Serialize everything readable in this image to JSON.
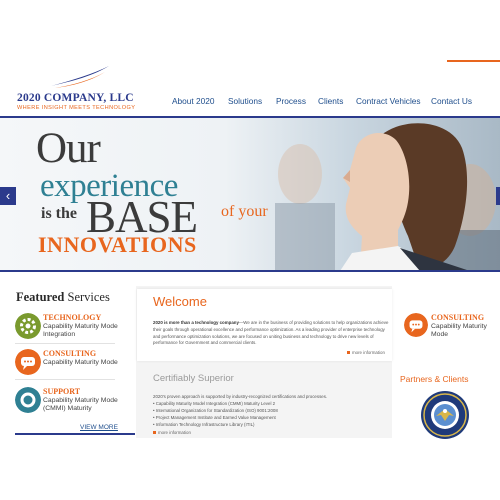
{
  "header": {
    "company_name": "2020 COMPANY, LLC",
    "tagline": "WHERE INSIGHT MEETS TECHNOLOGY",
    "nav": [
      "About 2020",
      "Solutions",
      "Process",
      "Clients",
      "Contract Vehicles",
      "Contact Us"
    ]
  },
  "hero": {
    "line1": "Our",
    "line2": "experience",
    "line3a": "is the",
    "line3b": "BASE",
    "line3c": "of your",
    "line4": "INNOVATIONS",
    "prev_icon": "chevron-left-icon"
  },
  "featured": {
    "title_bold": "Featured",
    "title_rest": " Services",
    "items": [
      {
        "name": "TECHNOLOGY",
        "desc": "Capability Maturity Mode Integration",
        "icon": "gear-icon",
        "color": "#7a9a2e"
      },
      {
        "name": "CONSULTING",
        "desc": "Capability Maturity Mode",
        "icon": "chat-icon",
        "color": "#e8661e"
      },
      {
        "name": "SUPPORT",
        "desc": "Capability Maturity Mode (CMMI) Maturity",
        "icon": "lifebuoy-icon",
        "color": "#2f8093"
      }
    ],
    "view_more": "VIEW MORE"
  },
  "welcome": {
    "title": "Welcome",
    "lead": "2020 is more than a technology company",
    "body": "—We are in the business of providing solutions to help organizations achieve their goals through operational excellence and performance optimization. As a leading provider of enterprise technology and performance optimization solutions, we are focused on uniting business and technology to drive new levels of performance for Government and commercial clients.",
    "more_info": "more information"
  },
  "certifiably": {
    "title": "Certifiably Superior",
    "intro": "2020's proven approach is supported by industry-recognized certifications and processes.",
    "items": [
      "• Capability Maturity Model Integration (CMMI) Maturity Level 2",
      "• International Organization for Standardization (ISO) 9001:2008",
      "• Project Management Institute and Earned Value Management",
      "• Information Technology Infrastructure Library (ITIL)"
    ],
    "more_info": "more information"
  },
  "right": {
    "service": {
      "name": "CONSULTING",
      "desc": "Capability Maturity Mode",
      "icon": "chat-icon",
      "color": "#e8661e"
    },
    "partners_title": "Partners & Clients",
    "seal_icon": "air-force-seal-icon"
  },
  "colors": {
    "navy": "#2b3a8c",
    "orange": "#e8661e",
    "teal": "#2f8093",
    "olive": "#7a9a2e"
  }
}
